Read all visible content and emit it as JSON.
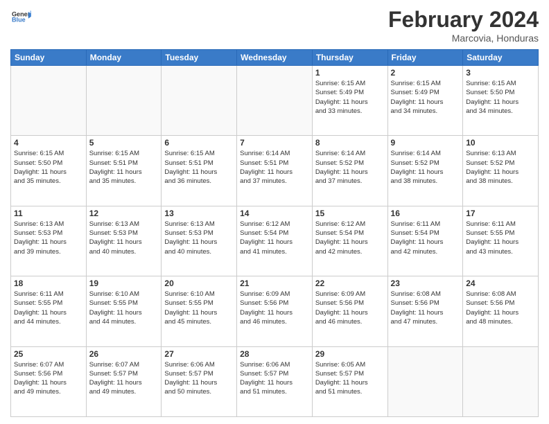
{
  "header": {
    "logo_line1": "General",
    "logo_line2": "Blue",
    "month_title": "February 2024",
    "location": "Marcovia, Honduras"
  },
  "weekdays": [
    "Sunday",
    "Monday",
    "Tuesday",
    "Wednesday",
    "Thursday",
    "Friday",
    "Saturday"
  ],
  "weeks": [
    [
      {
        "day": "",
        "info": ""
      },
      {
        "day": "",
        "info": ""
      },
      {
        "day": "",
        "info": ""
      },
      {
        "day": "",
        "info": ""
      },
      {
        "day": "1",
        "info": "Sunrise: 6:15 AM\nSunset: 5:49 PM\nDaylight: 11 hours\nand 33 minutes."
      },
      {
        "day": "2",
        "info": "Sunrise: 6:15 AM\nSunset: 5:49 PM\nDaylight: 11 hours\nand 34 minutes."
      },
      {
        "day": "3",
        "info": "Sunrise: 6:15 AM\nSunset: 5:50 PM\nDaylight: 11 hours\nand 34 minutes."
      }
    ],
    [
      {
        "day": "4",
        "info": "Sunrise: 6:15 AM\nSunset: 5:50 PM\nDaylight: 11 hours\nand 35 minutes."
      },
      {
        "day": "5",
        "info": "Sunrise: 6:15 AM\nSunset: 5:51 PM\nDaylight: 11 hours\nand 35 minutes."
      },
      {
        "day": "6",
        "info": "Sunrise: 6:15 AM\nSunset: 5:51 PM\nDaylight: 11 hours\nand 36 minutes."
      },
      {
        "day": "7",
        "info": "Sunrise: 6:14 AM\nSunset: 5:51 PM\nDaylight: 11 hours\nand 37 minutes."
      },
      {
        "day": "8",
        "info": "Sunrise: 6:14 AM\nSunset: 5:52 PM\nDaylight: 11 hours\nand 37 minutes."
      },
      {
        "day": "9",
        "info": "Sunrise: 6:14 AM\nSunset: 5:52 PM\nDaylight: 11 hours\nand 38 minutes."
      },
      {
        "day": "10",
        "info": "Sunrise: 6:13 AM\nSunset: 5:52 PM\nDaylight: 11 hours\nand 38 minutes."
      }
    ],
    [
      {
        "day": "11",
        "info": "Sunrise: 6:13 AM\nSunset: 5:53 PM\nDaylight: 11 hours\nand 39 minutes."
      },
      {
        "day": "12",
        "info": "Sunrise: 6:13 AM\nSunset: 5:53 PM\nDaylight: 11 hours\nand 40 minutes."
      },
      {
        "day": "13",
        "info": "Sunrise: 6:13 AM\nSunset: 5:53 PM\nDaylight: 11 hours\nand 40 minutes."
      },
      {
        "day": "14",
        "info": "Sunrise: 6:12 AM\nSunset: 5:54 PM\nDaylight: 11 hours\nand 41 minutes."
      },
      {
        "day": "15",
        "info": "Sunrise: 6:12 AM\nSunset: 5:54 PM\nDaylight: 11 hours\nand 42 minutes."
      },
      {
        "day": "16",
        "info": "Sunrise: 6:11 AM\nSunset: 5:54 PM\nDaylight: 11 hours\nand 42 minutes."
      },
      {
        "day": "17",
        "info": "Sunrise: 6:11 AM\nSunset: 5:55 PM\nDaylight: 11 hours\nand 43 minutes."
      }
    ],
    [
      {
        "day": "18",
        "info": "Sunrise: 6:11 AM\nSunset: 5:55 PM\nDaylight: 11 hours\nand 44 minutes."
      },
      {
        "day": "19",
        "info": "Sunrise: 6:10 AM\nSunset: 5:55 PM\nDaylight: 11 hours\nand 44 minutes."
      },
      {
        "day": "20",
        "info": "Sunrise: 6:10 AM\nSunset: 5:55 PM\nDaylight: 11 hours\nand 45 minutes."
      },
      {
        "day": "21",
        "info": "Sunrise: 6:09 AM\nSunset: 5:56 PM\nDaylight: 11 hours\nand 46 minutes."
      },
      {
        "day": "22",
        "info": "Sunrise: 6:09 AM\nSunset: 5:56 PM\nDaylight: 11 hours\nand 46 minutes."
      },
      {
        "day": "23",
        "info": "Sunrise: 6:08 AM\nSunset: 5:56 PM\nDaylight: 11 hours\nand 47 minutes."
      },
      {
        "day": "24",
        "info": "Sunrise: 6:08 AM\nSunset: 5:56 PM\nDaylight: 11 hours\nand 48 minutes."
      }
    ],
    [
      {
        "day": "25",
        "info": "Sunrise: 6:07 AM\nSunset: 5:56 PM\nDaylight: 11 hours\nand 49 minutes."
      },
      {
        "day": "26",
        "info": "Sunrise: 6:07 AM\nSunset: 5:57 PM\nDaylight: 11 hours\nand 49 minutes."
      },
      {
        "day": "27",
        "info": "Sunrise: 6:06 AM\nSunset: 5:57 PM\nDaylight: 11 hours\nand 50 minutes."
      },
      {
        "day": "28",
        "info": "Sunrise: 6:06 AM\nSunset: 5:57 PM\nDaylight: 11 hours\nand 51 minutes."
      },
      {
        "day": "29",
        "info": "Sunrise: 6:05 AM\nSunset: 5:57 PM\nDaylight: 11 hours\nand 51 minutes."
      },
      {
        "day": "",
        "info": ""
      },
      {
        "day": "",
        "info": ""
      }
    ]
  ]
}
